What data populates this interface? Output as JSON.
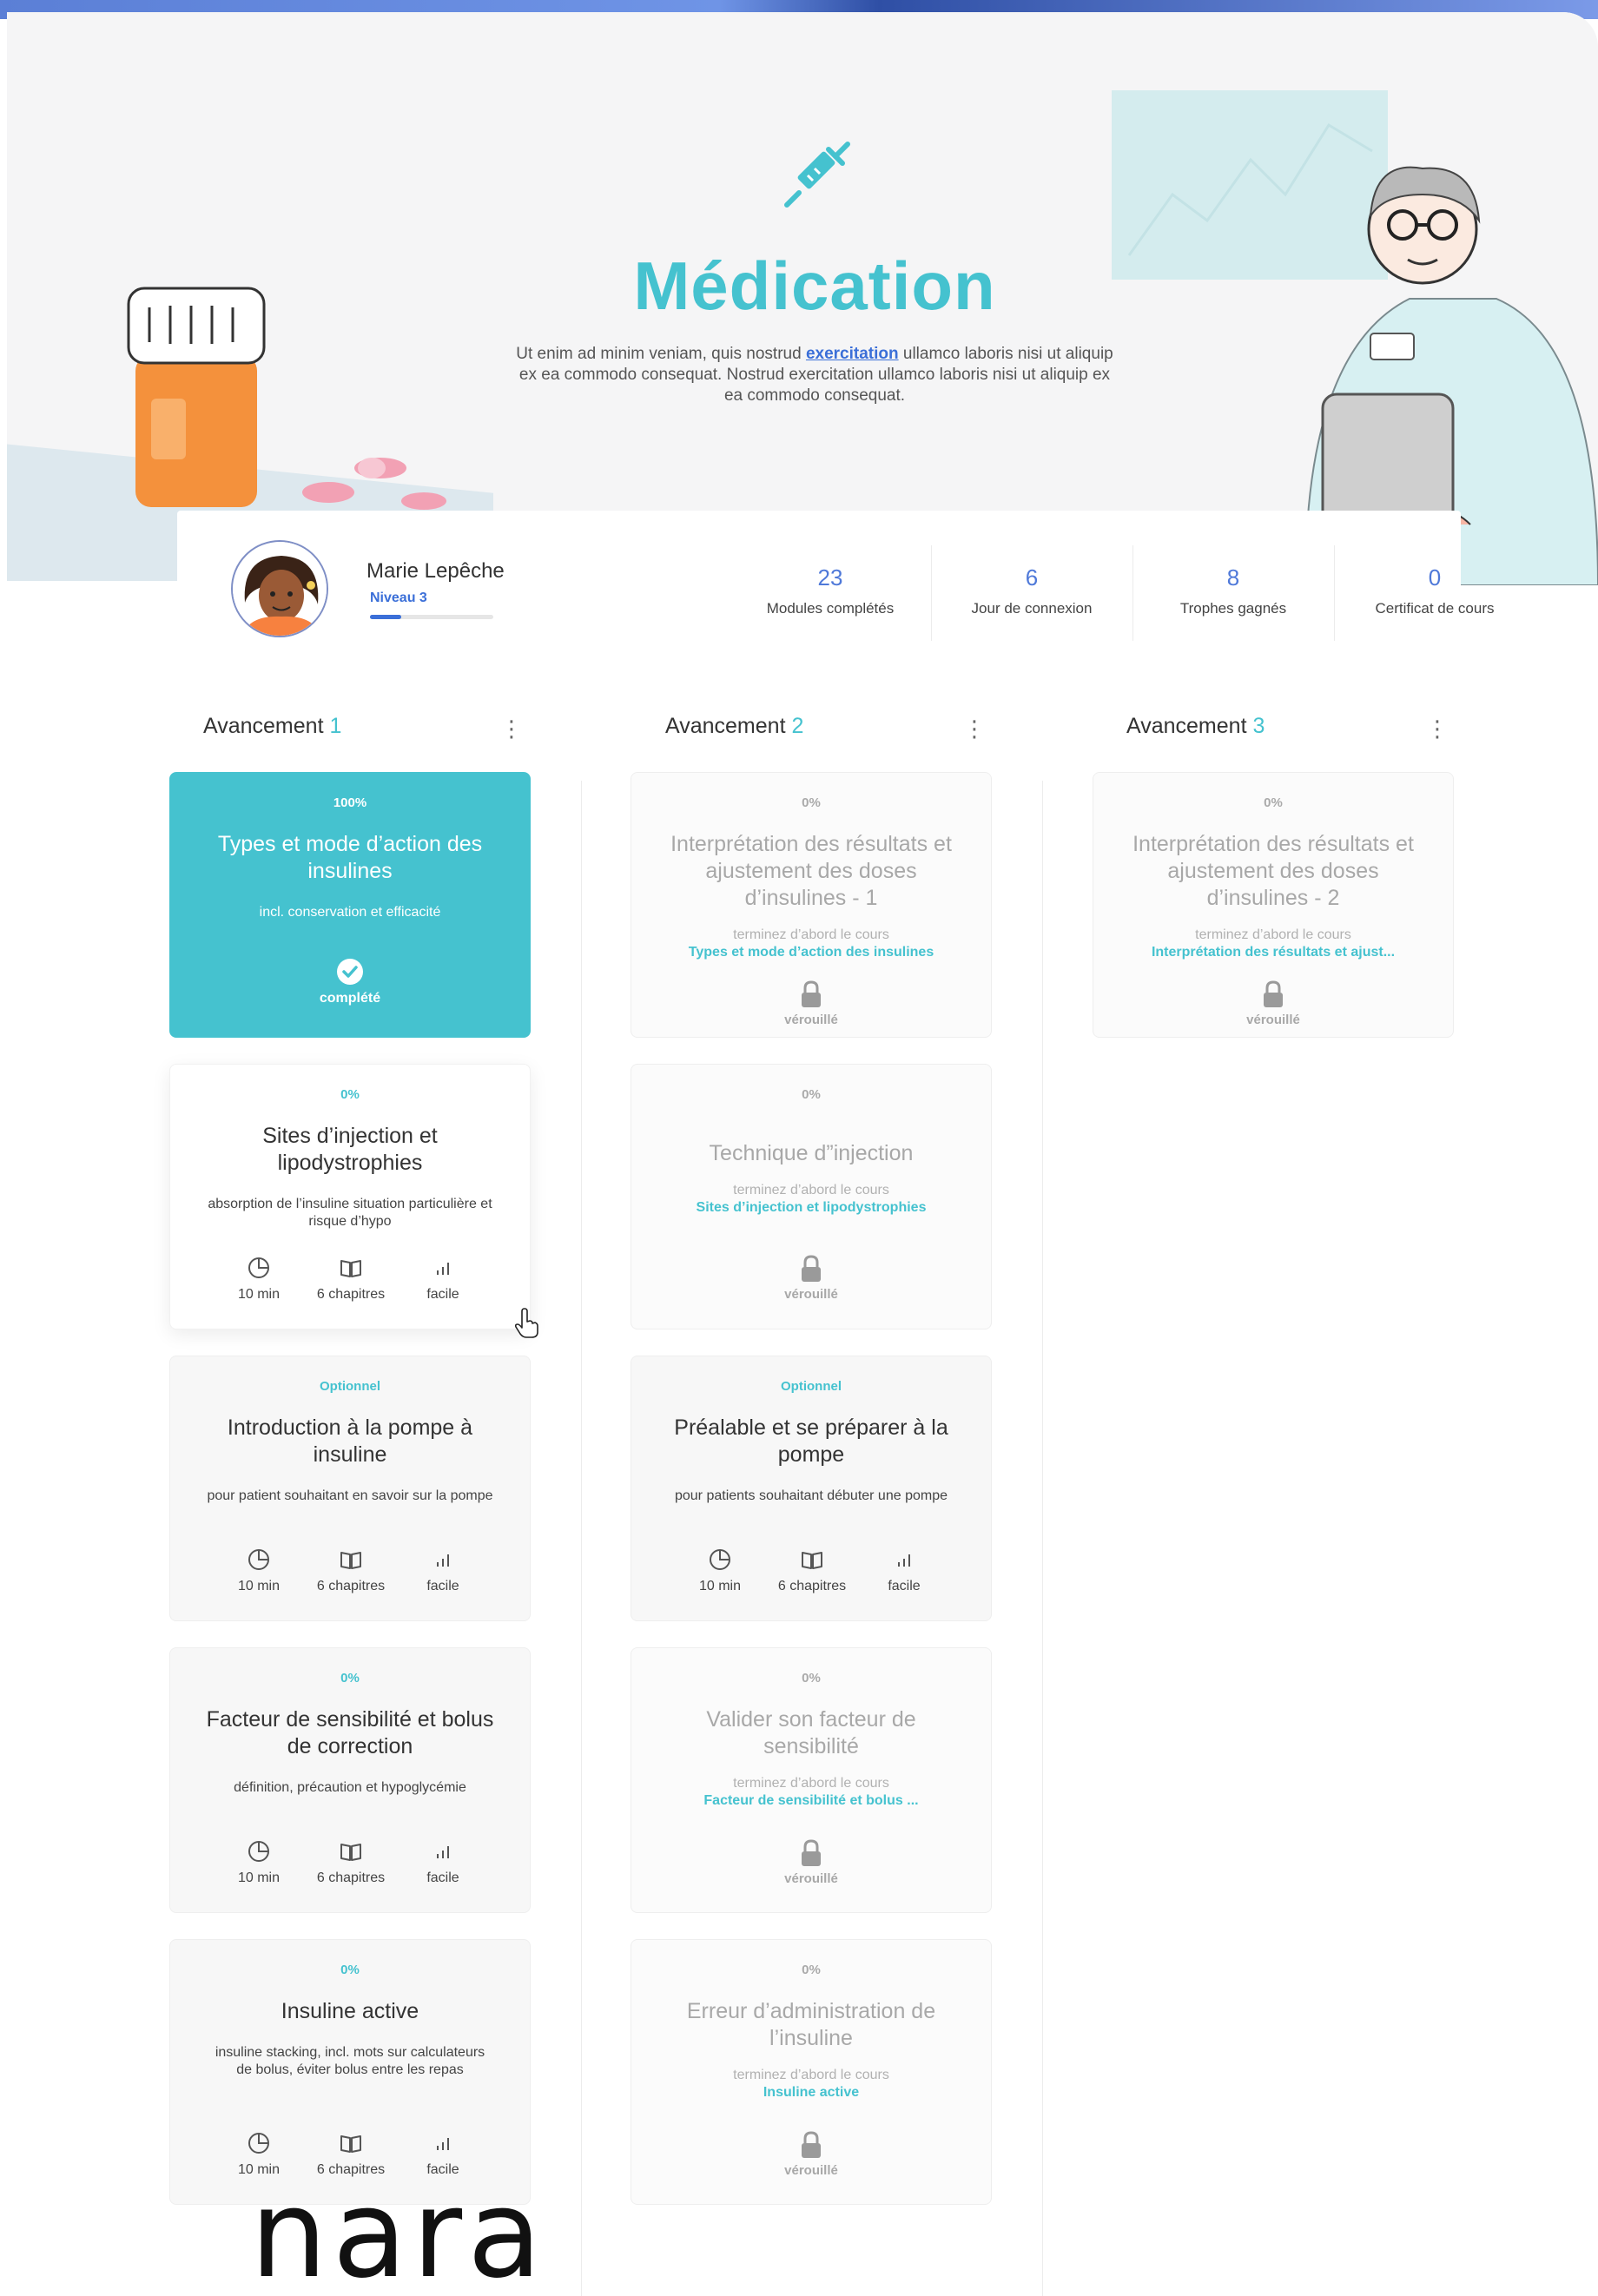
{
  "hero": {
    "title": "Médication",
    "description_before": "Ut enim ad minim veniam, quis nostrud ",
    "description_link": "exercitation",
    "description_after": " ullamco laboris nisi ut aliquip ex ea commodo consequat. Nostrud exercitation ullamco laboris nisi ut aliquip ex ea commodo consequat.",
    "icon": "syringe-icon"
  },
  "profile": {
    "name": "Marie Lepêche",
    "level": "Niveau 3",
    "level_progress": 0.25,
    "stats": [
      {
        "value": "23",
        "label": "Modules complétés"
      },
      {
        "value": "6",
        "label": "Jour de connexion"
      },
      {
        "value": "8",
        "label": "Trophes gagnés"
      },
      {
        "value": "0",
        "label": "Certificat de cours"
      }
    ]
  },
  "columns": [
    {
      "label": "Avancement",
      "number": "1"
    },
    {
      "label": "Avancement",
      "number": "2"
    },
    {
      "label": "Avancement",
      "number": "3"
    }
  ],
  "common": {
    "meta_duration": "10 min",
    "meta_chapters": "6 chapitres",
    "meta_level": "facile",
    "lock_note": "terminez d’abord le cours",
    "lock_label": "vérouillé",
    "done_label": "complété"
  },
  "cards": {
    "c1_1": {
      "tag": "100%",
      "title": "Types et mode d’action des insulines",
      "desc": "incl. conservation et efficacité"
    },
    "c1_2": {
      "tag": "0%",
      "title": "Sites d’injection et lipodystrophies",
      "desc": "absorption de l’insuline situation particulière et risque d’hypo"
    },
    "c1_3": {
      "tag": "Optionnel",
      "title": "Introduction à la pompe à insuline",
      "desc": "pour patient souhaitant en savoir sur la pompe"
    },
    "c1_4": {
      "tag": "0%",
      "title": "Facteur de sensibilité et bolus de correction",
      "desc": "définition, précaution et hypoglycémie"
    },
    "c1_5": {
      "tag": "0%",
      "title": "Insuline active",
      "desc": "insuline stacking, incl. mots sur calculateurs de bolus, éviter bolus entre les repas"
    },
    "c2_1": {
      "tag": "0%",
      "title": "Interprétation des résultats et ajustement des doses d’insulines - 1",
      "course": "Types et mode d’action des insulines"
    },
    "c2_2": {
      "tag": "0%",
      "title": "Technique d”injection",
      "course": "Sites d’injection et lipodystrophies"
    },
    "c2_3": {
      "tag": "Optionnel",
      "title": "Préalable et se préparer à la pompe",
      "desc": "pour patients souhaitant débuter une pompe"
    },
    "c2_4": {
      "tag": "0%",
      "title": "Valider son facteur de sensibilité",
      "course": "Facteur de sensibilité et bolus ..."
    },
    "c2_5": {
      "tag": "0%",
      "title": "Erreur d’administration de l’insuline",
      "course": "Insuline active"
    },
    "c3_1": {
      "tag": "0%",
      "title": "Interprétation des résultats et ajustement des doses d’insulines - 2",
      "course": "Interprétation des résultats et ajust..."
    }
  },
  "brand": "nara",
  "colors": {
    "accent": "#45c2cf",
    "link": "#3b6fd8",
    "stat": "#4f79d9"
  }
}
